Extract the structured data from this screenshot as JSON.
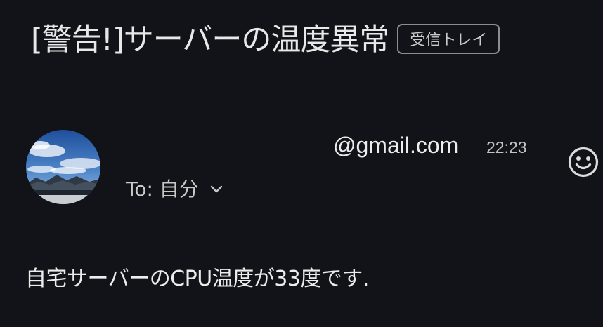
{
  "email": {
    "subject": "[警告!]サーバーの温度異常",
    "label": "受信トレイ",
    "sender_email": "@gmail.com",
    "time": "22:23",
    "recipient": "To: 自分",
    "body": "自宅サーバーのCPU温度が33度です."
  },
  "icons": {
    "avatar": "avatar-photo-mountain-sky",
    "reaction": "smiley-face-icon",
    "expand": "chevron-down-icon"
  },
  "colors": {
    "background": "#111318",
    "text": "#e3e3e3",
    "chip_border": "#8a8d91"
  }
}
